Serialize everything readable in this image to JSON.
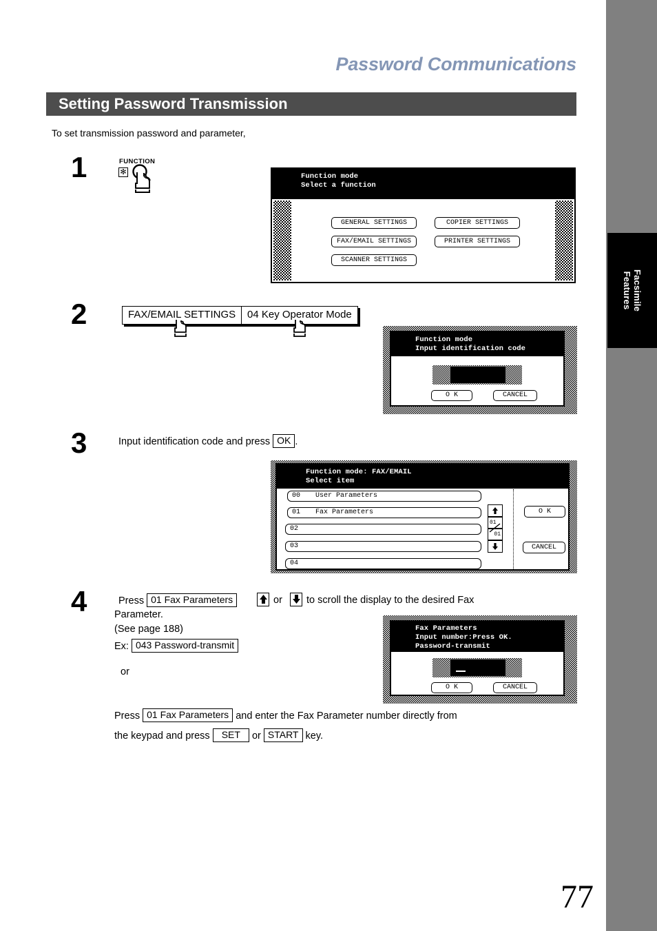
{
  "header": {
    "chapter_title": "Password Communications",
    "section_title": "Setting  Password Transmission",
    "intro": "To set transmission password and parameter,"
  },
  "index_tab": {
    "label": "Facsimile\nFeatures"
  },
  "page_number": "77",
  "colors": {
    "chapter_title": "#8496b5",
    "section_bar": "#4d4d4d",
    "right_band": "#808080",
    "index_tab": "#000000"
  },
  "steps": [
    {
      "number": "1",
      "function_label": "FUNCTION",
      "star_key": "✻",
      "icons": [
        "function-key-icon",
        "hand-pointer-icon"
      ]
    },
    {
      "number": "2",
      "buttons": [
        {
          "label": "FAX/EMAIL SETTINGS"
        },
        {
          "label": "04 Key Operator Mode"
        }
      ]
    },
    {
      "number": "3",
      "text_before": "Input identification code and press",
      "keycap": "OK",
      "text_after": "."
    },
    {
      "number": "4",
      "line1_a": "Press",
      "line1_key": "01 Fax Parameters",
      "line1_b": "or",
      "line1_c": "to scroll the display to the desired Fax",
      "line2": "Parameter.",
      "line3": "(See page 188)",
      "ex_label": "Ex:",
      "ex_key": "043 Password-transmit",
      "or_label": "or",
      "line4_a": "Press",
      "line4_key": "01 Fax Parameters",
      "line4_b": "and enter the Fax Parameter number directly from",
      "line5_a": "the keypad and press",
      "line5_key1": "SET",
      "line5_b": "or",
      "line5_key2": "START",
      "line5_c": "key."
    }
  ],
  "lcd_panels": [
    {
      "id": "function-mode-select",
      "header_lines": [
        "Function mode",
        "Select a function"
      ],
      "buttons": [
        "GENERAL SETTINGS",
        "COPIER SETTINGS",
        "FAX/EMAIL SETTINGS",
        "PRINTER SETTINGS",
        "SCANNER SETTINGS"
      ]
    },
    {
      "id": "input-identification-code",
      "header_lines": [
        "Function mode",
        "Input identification code"
      ],
      "input_value": "",
      "ok_label": "O K",
      "cancel_label": "CANCEL"
    },
    {
      "id": "fax-email-select-item",
      "header_lines": [
        "Function mode: FAX/EMAIL",
        "Select item"
      ],
      "rows": [
        {
          "index": "00",
          "label": "User Parameters"
        },
        {
          "index": "01",
          "label": "Fax Parameters"
        },
        {
          "index": "02",
          "label": ""
        },
        {
          "index": "03",
          "label": ""
        },
        {
          "index": "04",
          "label": ""
        }
      ],
      "scroll": {
        "top": "01",
        "bottom": "01"
      },
      "ok_label": "O K",
      "cancel_label": "CANCEL"
    },
    {
      "id": "fax-parameters-input-number",
      "header_lines": [
        "Fax Parameters",
        "Input number:Press OK.",
        "Password-transmit"
      ],
      "input_value": "_",
      "ok_label": "O K",
      "cancel_label": "CANCEL"
    }
  ]
}
